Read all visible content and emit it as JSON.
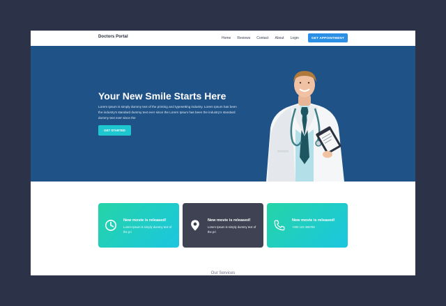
{
  "navbar": {
    "brand": "Doctors Portal",
    "links": [
      "Home",
      "Reviews",
      "Contact",
      "About",
      "Login"
    ],
    "cta_label": "GET APPOINTMENT"
  },
  "hero": {
    "title": "Your New Smile Starts Here",
    "text": "Lorem Ipsum is simply dummy text of the printing and typesetting industry. Lorem Ipsum has been the industry's standard dummy text ever since the Lorem Ipsum has been the industry's standard dummy text ever since the",
    "button_label": "GET STARTED"
  },
  "cards": [
    {
      "icon": "clock-icon",
      "title": "New movie is released!",
      "text": "Lorem Ipsum is simply dummy text of the pri"
    },
    {
      "icon": "location-pin-icon",
      "title": "New movie is released!",
      "text": "Lorem Ipsum is simply dummy text of the pri"
    },
    {
      "icon": "phone-icon",
      "title": "New movie is released!",
      "text": "+000 123 456789"
    }
  ],
  "services_heading": "Our Services",
  "colors": {
    "page_bg": "#2c3247",
    "hero_bg": "#1f5287",
    "accent_blue": "#2b8fe6",
    "accent_teal": "#1ec6cf",
    "card_dark": "#3e4252"
  }
}
